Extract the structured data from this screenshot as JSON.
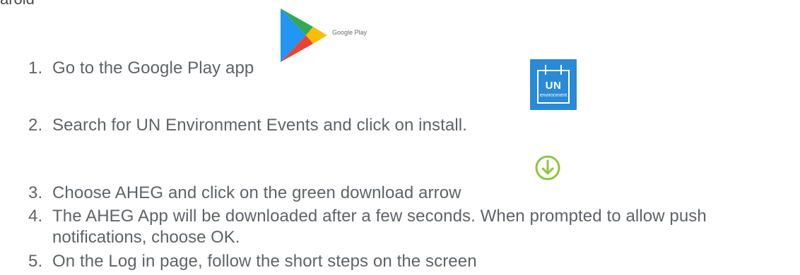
{
  "header_fragment": "aroid",
  "google_play": {
    "caption": "Google Play",
    "icon": "google-play-logo"
  },
  "un_icon": {
    "icon": "un-environment-events-app-icon",
    "logo_text": "UN",
    "sub_text": "environment",
    "color": "#2a8ad6"
  },
  "download_icon": {
    "icon": "green-download-arrow-icon",
    "color": "#8cc63f"
  },
  "steps": [
    {
      "num": "1.",
      "text": "Go to the Google Play app"
    },
    {
      "num": "2.",
      "text": "Search for UN Environment Events and click on install."
    },
    {
      "num": "3.",
      "text": "Choose AHEG and click on the green download arrow"
    },
    {
      "num": "4.",
      "text": "The AHEG App will be downloaded after a few seconds. When prompted to allow push",
      "continuation": "notifications, choose OK."
    },
    {
      "num": "5.",
      "text": "On the Log in page, follow the short steps on the screen"
    }
  ]
}
